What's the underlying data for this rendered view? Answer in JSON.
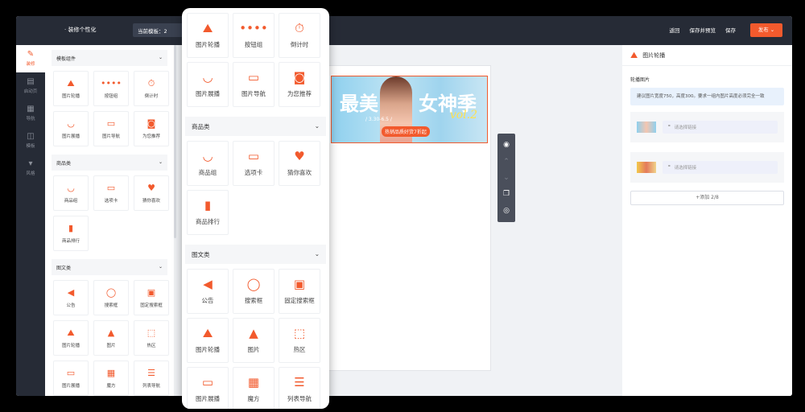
{
  "topbar": {
    "title": "· 装修个性化",
    "template_select": "当前模板：2",
    "actions": [
      "返回",
      "保存并预览",
      "保存"
    ],
    "publish": "发布 ⌄"
  },
  "rail": [
    {
      "label": "装修",
      "icon": "brush-icon",
      "glyph": "✎",
      "active": true
    },
    {
      "label": "启动页",
      "icon": "document-icon",
      "glyph": "▤",
      "active": false
    },
    {
      "label": "导航",
      "icon": "grid-icon",
      "glyph": "▦",
      "active": false
    },
    {
      "label": "模板",
      "icon": "layout-icon",
      "glyph": "◫",
      "active": false
    },
    {
      "label": "风格",
      "icon": "shirt-icon",
      "glyph": "▾",
      "active": false
    }
  ],
  "panel": {
    "groups": [
      {
        "title": "模板组件",
        "items": [
          {
            "label": "图片轮播",
            "icon": "image-carousel-icon",
            "glyph": "⛰"
          },
          {
            "label": "按钮组",
            "icon": "button-group-icon",
            "glyph": "••••"
          },
          {
            "label": "倒计时",
            "icon": "countdown-icon",
            "glyph": "⏱"
          },
          {
            "label": "图片展播",
            "icon": "image-showcase-icon",
            "glyph": "◡"
          },
          {
            "label": "图片导航",
            "icon": "image-nav-icon",
            "glyph": "▭"
          },
          {
            "label": "为您推荐",
            "icon": "recommend-icon",
            "glyph": "◙"
          }
        ]
      },
      {
        "title": "商品类",
        "items": [
          {
            "label": "商品组",
            "icon": "product-group-icon",
            "glyph": "◡"
          },
          {
            "label": "选项卡",
            "icon": "tab-card-icon",
            "glyph": "▭"
          },
          {
            "label": "猜你喜欢",
            "icon": "heart-icon",
            "glyph": "♥"
          },
          {
            "label": "商品排行",
            "icon": "bar-rank-icon",
            "glyph": "▮"
          }
        ]
      },
      {
        "title": "图文类",
        "items": [
          {
            "label": "公告",
            "icon": "speaker-icon",
            "glyph": "◀"
          },
          {
            "label": "搜索框",
            "icon": "search-icon",
            "glyph": "◯"
          },
          {
            "label": "固定搜索框",
            "icon": "fixed-search-icon",
            "glyph": "▣"
          },
          {
            "label": "图片轮播",
            "icon": "image-carousel-icon",
            "glyph": "⛰"
          },
          {
            "label": "图片",
            "icon": "image-icon",
            "glyph": "▲"
          },
          {
            "label": "热区",
            "icon": "hotspot-icon",
            "glyph": "⬚"
          },
          {
            "label": "图片展播",
            "icon": "image-showcase-icon",
            "glyph": "▭"
          },
          {
            "label": "魔方",
            "icon": "magic-cube-icon",
            "glyph": "▦"
          },
          {
            "label": "列表导航",
            "icon": "list-nav-icon",
            "glyph": "☰"
          }
        ]
      }
    ]
  },
  "banner": {
    "text_left": "最美",
    "text_right": "女神季",
    "date": "/ 3.30-6.5 /",
    "tag": "热销品质好货7折起",
    "vol": "vol.2"
  },
  "right": {
    "title": "图片轮播",
    "subtitle": "轮播图片",
    "tip": "建议图片宽度750，高度300。要求一组内图片高度必须完全一致",
    "link_placeholder": "请选择链接",
    "add_button": "+添加 2/8"
  },
  "colors": {
    "accent": "#f25a2d",
    "dark": "#262b36"
  }
}
